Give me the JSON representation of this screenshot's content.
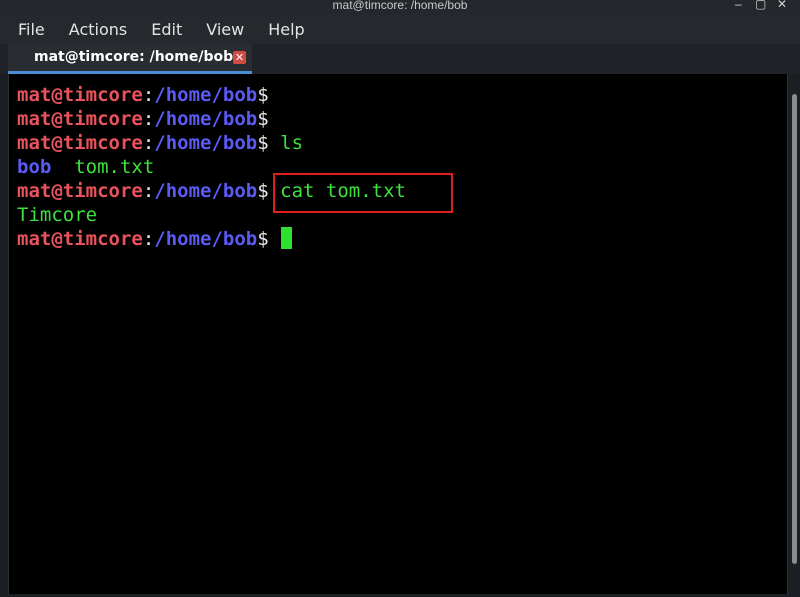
{
  "window": {
    "title": "mat@timcore: /home/bob",
    "controls": {
      "minimize": "–",
      "maximize": "▢",
      "close": "✕"
    }
  },
  "menubar": {
    "items": [
      "File",
      "Actions",
      "Edit",
      "View",
      "Help"
    ]
  },
  "tabs": [
    {
      "label": "mat@timcore: /home/bob",
      "close_icon": "✕"
    }
  ],
  "terminal": {
    "prompt": {
      "user": "mat@timcore",
      "colon": ":",
      "path": "/home/bob",
      "dollar": "$"
    },
    "lines": [
      {
        "type": "prompt",
        "command": ""
      },
      {
        "type": "prompt",
        "command": ""
      },
      {
        "type": "prompt",
        "command": "ls"
      },
      {
        "type": "listing",
        "dir": "bob",
        "file": "tom.txt"
      },
      {
        "type": "prompt",
        "command": "cat tom.txt"
      },
      {
        "type": "output",
        "text": "Timcore"
      },
      {
        "type": "prompt",
        "command": ""
      }
    ]
  },
  "colors": {
    "prompt_user": "#e8525c",
    "prompt_path": "#5b5af4",
    "command": "#3ee13e",
    "highlight": "#e0201d",
    "tab_accent": "#4c8dd9"
  }
}
